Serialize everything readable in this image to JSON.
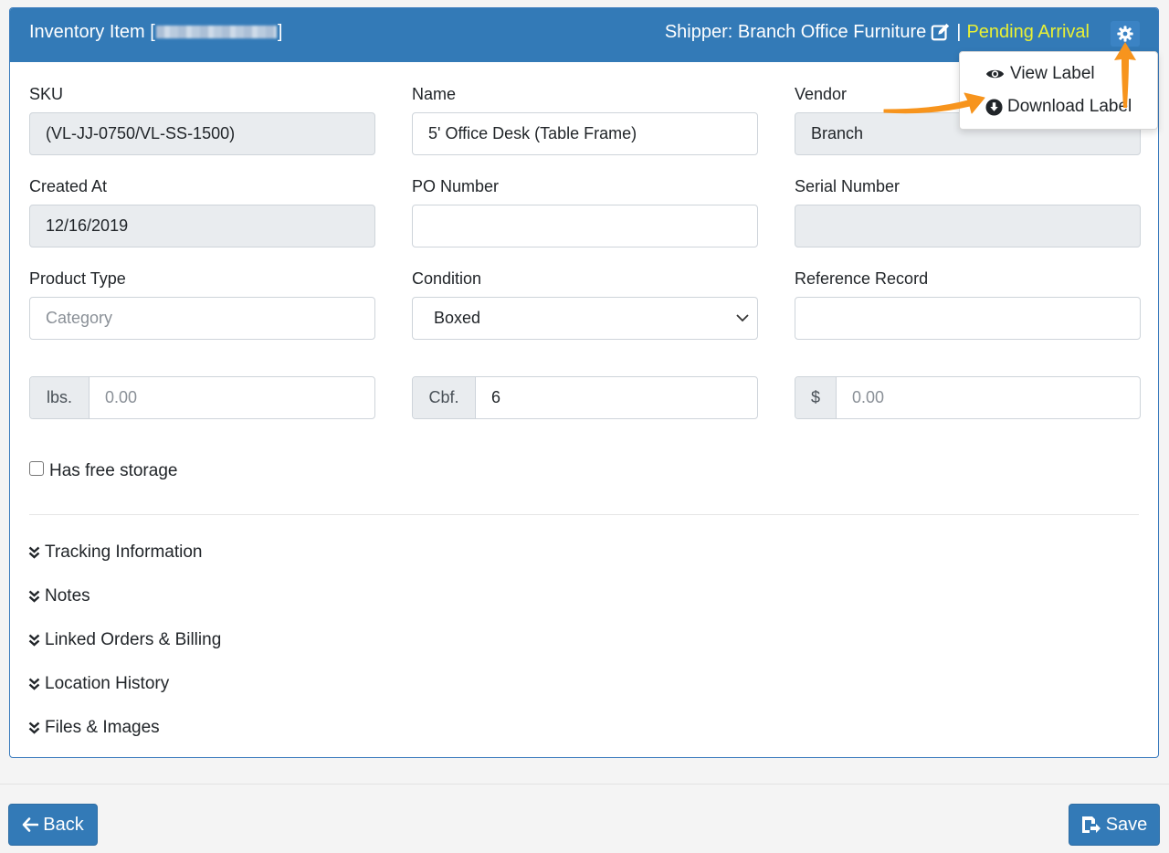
{
  "header": {
    "title_prefix": "Inventory Item [",
    "title_suffix": "]",
    "shipper": "Shipper: Branch Office Furniture",
    "separator": "|",
    "status": "Pending Arrival",
    "status_color": "#e8f035",
    "accent_color": "#337ab7"
  },
  "settings_menu": {
    "items": [
      {
        "label": "View Label",
        "icon": "eye-icon"
      },
      {
        "label": "Download Label",
        "icon": "download-circle-icon"
      }
    ]
  },
  "form": {
    "sku": {
      "label": "SKU",
      "value": "(VL-JJ-0750/VL-SS-1500)"
    },
    "name": {
      "label": "Name",
      "value": "5' Office Desk (Table Frame)"
    },
    "vendor": {
      "label": "Vendor",
      "value": "Branch"
    },
    "created_at": {
      "label": "Created At",
      "value": "12/16/2019"
    },
    "po_number": {
      "label": "PO Number",
      "value": ""
    },
    "serial_number": {
      "label": "Serial Number",
      "value": ""
    },
    "product_type": {
      "label": "Product Type",
      "placeholder": "Category"
    },
    "condition": {
      "label": "Condition",
      "value": "Boxed"
    },
    "reference_record": {
      "label": "Reference Record",
      "value": ""
    },
    "weight": {
      "addon": "lbs.",
      "placeholder": "0.00"
    },
    "cbf": {
      "addon": "Cbf.",
      "value": "6"
    },
    "price": {
      "addon": "$",
      "placeholder": "0.00"
    },
    "free_storage": {
      "label": "Has free storage",
      "checked": false
    }
  },
  "sections": [
    "Tracking Information",
    "Notes",
    "Linked Orders & Billing",
    "Location History",
    "Files & Images"
  ],
  "footer": {
    "back_label": "Back",
    "save_label": "Save"
  }
}
